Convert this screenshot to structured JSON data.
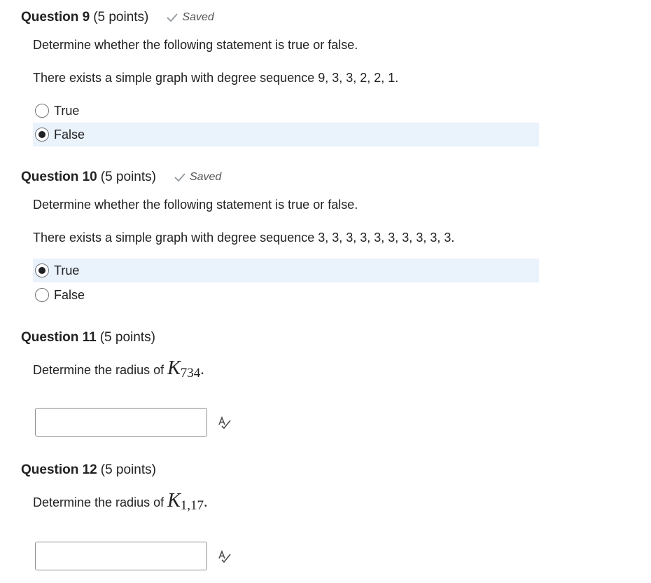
{
  "questions": [
    {
      "title": "Question 9",
      "points": "(5 points)",
      "status": "Saved",
      "prompt": "Determine whether the following statement is true or false.",
      "statement": "There exists a simple graph with degree sequence 9, 3, 3, 2, 2, 1.",
      "options": [
        {
          "label": "True",
          "selected": false
        },
        {
          "label": "False",
          "selected": true
        }
      ]
    },
    {
      "title": "Question 10",
      "points": "(5 points)",
      "status": "Saved",
      "prompt": "Determine whether the following statement is true or false.",
      "statement": "There exists a simple graph with degree sequence 3, 3, 3, 3, 3, 3, 3, 3, 3, 3.",
      "options": [
        {
          "label": "True",
          "selected": true
        },
        {
          "label": "False",
          "selected": false
        }
      ]
    },
    {
      "title": "Question 11",
      "points": "(5 points)",
      "prompt": "Determine the radius of",
      "math_symbol": "K",
      "math_subscript": "734",
      "answer_value": ""
    },
    {
      "title": "Question 12",
      "points": "(5 points)",
      "prompt": "Determine the radius of",
      "math_symbol": "K",
      "math_subscript": "1,17",
      "answer_value": ""
    }
  ],
  "icons": {
    "saved": "checkmark-icon",
    "spellcheck": "spellcheck-icon"
  },
  "colors": {
    "selected_option_bg": "#eaf2fc",
    "text": "#202122",
    "saved_text": "#555555"
  }
}
